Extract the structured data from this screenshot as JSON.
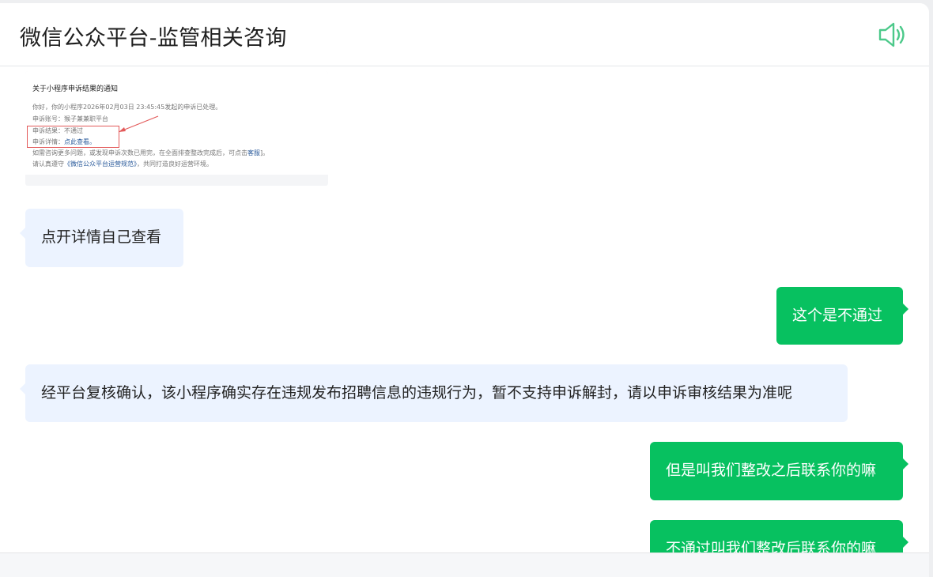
{
  "header": {
    "title": "微信公众平台-监管相关咨询",
    "speaker_icon": "speaker-volume-icon",
    "accent_color": "#07c160"
  },
  "screenshot": {
    "title": "关于小程序申诉结果的通知",
    "line1": "你好，你的小程序2026年02月03日 23:45:45发起的申诉已处理。",
    "line2": "申诉账号：猴子兼兼职平台",
    "line3": "申诉结果：不通过",
    "line4_label": "申诉详情：",
    "line4_link": "点此查看。",
    "line5": "如需咨询更多问题，或发现申诉次数已用完，在全面排查整改完成后，可点击",
    "line5_link": "客服",
    "line5_tail": "]。",
    "line6_pre": "请认真遵守",
    "line6_link": "《微信公众平台运营规范》",
    "line6_tail": "，共同打造良好运营环境。"
  },
  "messages": [
    {
      "side": "left",
      "text": "点开详情自己查看"
    },
    {
      "side": "right",
      "text": "这个是不通过"
    },
    {
      "side": "left",
      "text": "经平台复核确认，该小程序确实存在违规发布招聘信息的违规行为，暂不支持申诉解封，请以申诉审核结果为准呢"
    },
    {
      "side": "right",
      "text": "但是叫我们整改之后联系你的嘛"
    },
    {
      "side": "right",
      "text": "不通过叫我们整改后联系你的嘛"
    }
  ],
  "colors": {
    "agent_bubble": "#ecf3ff",
    "user_bubble": "#07c160"
  }
}
